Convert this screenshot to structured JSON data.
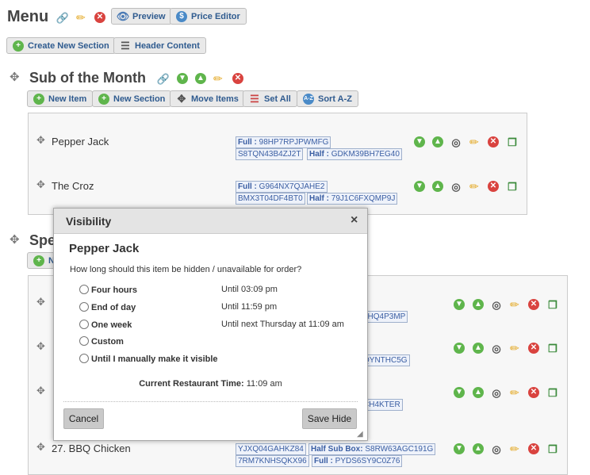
{
  "page": {
    "menu_title": "Menu",
    "preview_label": "Preview",
    "price_editor_label": "Price Editor",
    "create_section_label": "Create New Section",
    "header_content_label": "Header Content"
  },
  "section1": {
    "title": "Sub of the Month",
    "toolbar": {
      "new_item": "New Item",
      "new_section": "New Section",
      "move_items": "Move Items",
      "set_all": "Set All",
      "sort": "Sort A-Z"
    },
    "items": [
      {
        "name": "Pepper Jack",
        "codes": [
          {
            "label": "Full :",
            "value": "98HP7RPJPWMFG"
          },
          {
            "label": "",
            "value": "S8TQN43B4ZJ2T"
          },
          {
            "label": "Half :",
            "value": "GDKM39BH7EG40"
          }
        ]
      },
      {
        "name": "The Croz",
        "codes": [
          {
            "label": "Full :",
            "value": "G964NX7QJAHE2"
          },
          {
            "label": "",
            "value": "BMX3T04DF4BT0"
          },
          {
            "label": "Half :",
            "value": "79J1C6FXQMP9J"
          }
        ]
      }
    ]
  },
  "section2": {
    "title_partial": "Spe",
    "new_partial": "N",
    "codes_partial": [
      "6HQ4P3MP",
      "QYNTHC5G",
      "CH4KTER"
    ],
    "item_27": {
      "name": "27. BBQ Chicken",
      "codes": [
        {
          "label": "",
          "value": "YJXQ04GAHKZ84"
        },
        {
          "label": "Half Sub Box:",
          "value": "S8RW63AGC191G"
        },
        {
          "label": "",
          "value": "7RM7KNHSQKX96"
        },
        {
          "label": "Full :",
          "value": "PYDS6SY9C0Z76"
        }
      ]
    }
  },
  "modal": {
    "title": "Visibility",
    "close_glyph": "×",
    "item_name": "Pepper Jack",
    "question": "How long should this item be hidden / unavailable for order?",
    "options": [
      {
        "label": "Four hours",
        "until": "Until 03:09 pm"
      },
      {
        "label": "End of day",
        "until": "Until 11:59 pm"
      },
      {
        "label": "One week",
        "until": "Until next Thursday at 11:09 am"
      },
      {
        "label": "Custom",
        "until": ""
      },
      {
        "label": "Until I manually make it visible",
        "until": ""
      }
    ],
    "time_label": "Current Restaurant Time:",
    "time_value": "11:09 am",
    "cancel": "Cancel",
    "save": "Save Hide"
  }
}
